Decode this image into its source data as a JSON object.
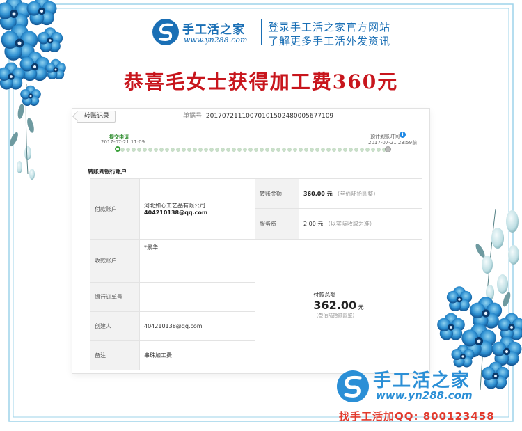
{
  "header": {
    "brand_name": "手工活之家",
    "brand_url": "www.yn288.com",
    "slogan_line1": "登录手工活之家官方网站",
    "slogan_line2": "了解更多手工活外发资讯"
  },
  "headline": "恭喜毛女士获得加工费360元",
  "record": {
    "back_label": "转账记录",
    "order_label": "单据号:",
    "order_no": "20170721110070101502480005677109",
    "step_start_label": "提交申请",
    "step_start_time": "2017-07-21 11:09",
    "step_end_label": "预计到账时间",
    "step_end_time": "2017-07-21 23:59前",
    "section_title": "转账到银行账户",
    "payer_label": "付款账户",
    "payer_company": "河北如心工艺品有限公司",
    "payer_email": "404210138@qq.com",
    "amount_label": "转账金额",
    "amount_value": "360.00 元",
    "amount_caps": "（叁佰陆拾圆整）",
    "fee_label": "服务费",
    "fee_value": "2.00 元",
    "fee_note": "（以实际收取为准）",
    "payee_label": "收款账户",
    "payee_value": "*景华",
    "bank_order_label": "银行订单号",
    "bank_order_value": "",
    "creator_label": "创建人",
    "creator_value": "404210138@qq.com",
    "memo_label": "备注",
    "memo_value": "串珠加工费",
    "total_label": "付款总额",
    "total_amount": "362.00",
    "total_unit": "元",
    "total_caps": "（叁佰陆拾贰圆整）",
    "info_icon": "info-icon"
  },
  "footer": {
    "brand_name": "手工活之家",
    "brand_url": "www.yn288.com",
    "qq_line": "找手工活加QQ: 800123458"
  },
  "colors": {
    "brand_blue": "#1a6fb5",
    "headline_red": "#c8161d",
    "step_green": "#3aa03a",
    "qq_red": "#e23a2d"
  }
}
